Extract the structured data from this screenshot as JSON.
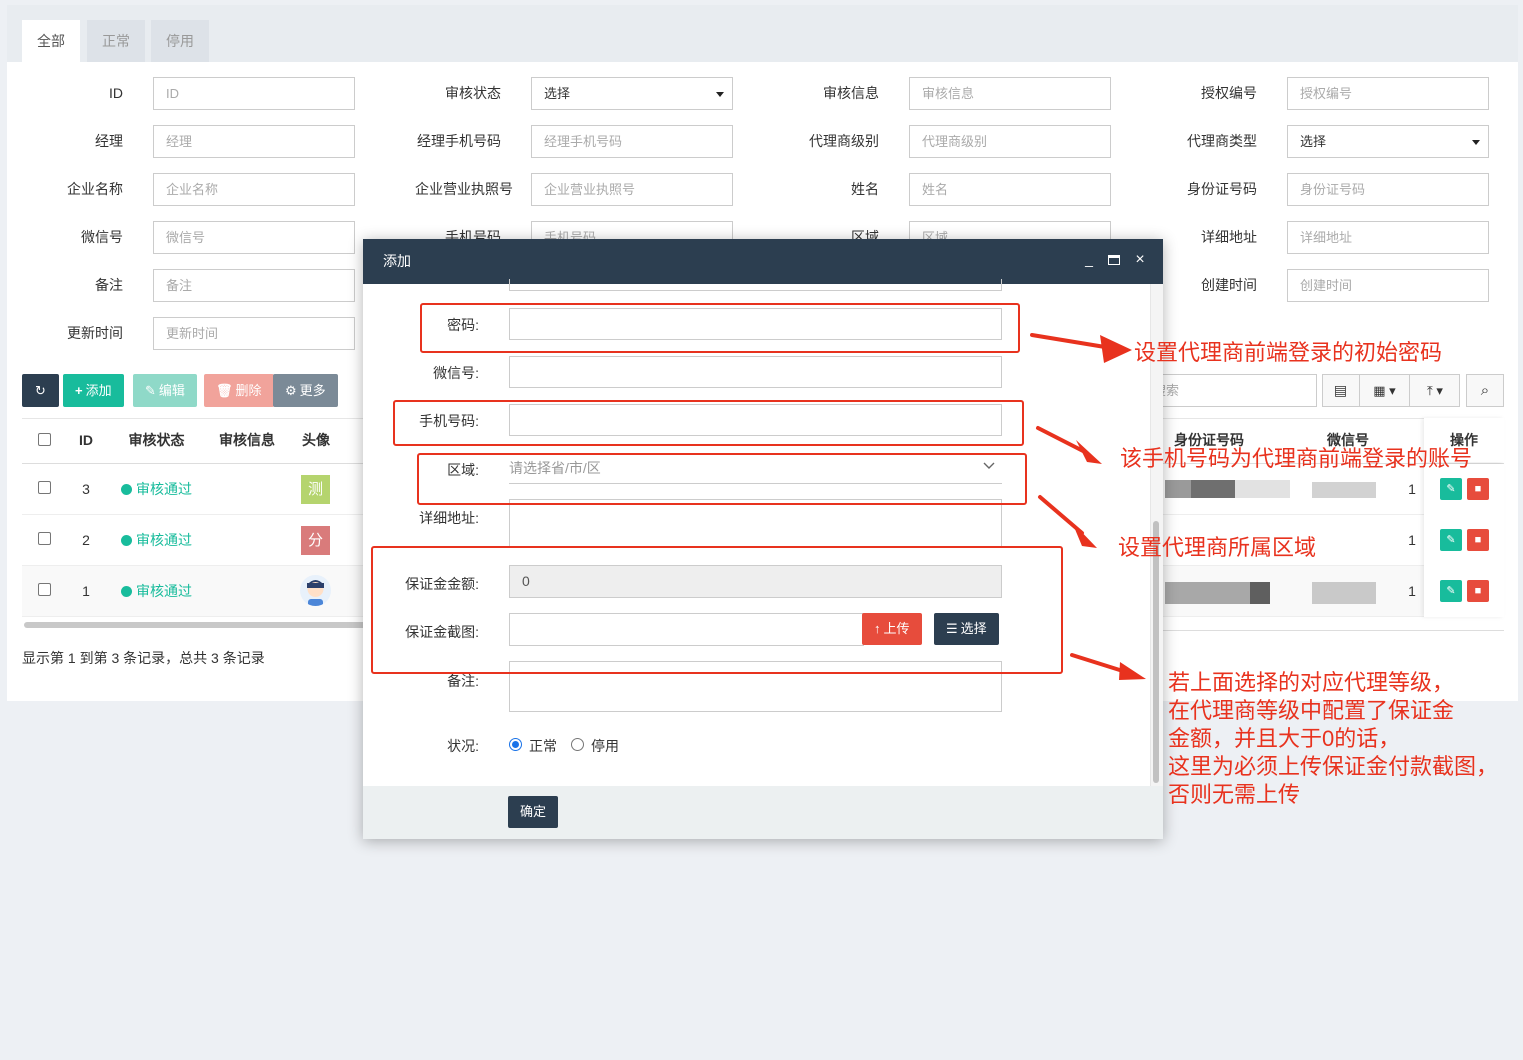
{
  "tabs": [
    {
      "label": "全部"
    },
    {
      "label": "正常"
    },
    {
      "label": "停用"
    }
  ],
  "filters": {
    "id": {
      "label": "ID",
      "placeholder": "ID"
    },
    "audit_status": {
      "label": "审核状态",
      "value": "选择"
    },
    "audit_info": {
      "label": "审核信息",
      "placeholder": "审核信息"
    },
    "auth_no": {
      "label": "授权编号",
      "placeholder": "授权编号"
    },
    "manager": {
      "label": "经理",
      "placeholder": "经理"
    },
    "manager_phone": {
      "label": "经理手机号码",
      "placeholder": "经理手机号码"
    },
    "agent_level": {
      "label": "代理商级别",
      "placeholder": "代理商级别"
    },
    "agent_type": {
      "label": "代理商类型",
      "value": "选择"
    },
    "company": {
      "label": "企业名称",
      "placeholder": "企业名称"
    },
    "license": {
      "label": "企业营业执照号",
      "placeholder": "企业营业执照号"
    },
    "name": {
      "label": "姓名",
      "placeholder": "姓名"
    },
    "idcard": {
      "label": "身份证号码",
      "placeholder": "身份证号码"
    },
    "wechat": {
      "label": "微信号",
      "placeholder": "微信号"
    },
    "phone": {
      "label": "手机号码",
      "placeholder": "手机号码"
    },
    "region": {
      "label": "区域",
      "placeholder": "区域"
    },
    "address": {
      "label": "详细地址",
      "placeholder": "详细地址"
    },
    "remark": {
      "label": "备注",
      "placeholder": "备注"
    },
    "created": {
      "label": "创建时间",
      "placeholder": "创建时间"
    },
    "updated": {
      "label": "更新时间",
      "placeholder": "更新时间"
    }
  },
  "toolbar": {
    "add": "添加",
    "edit": "编辑",
    "delete": "删除",
    "more": "更多",
    "search_placeholder": "搜索"
  },
  "table": {
    "headers": {
      "id": "ID",
      "status": "审核状态",
      "info": "审核信息",
      "avatar": "头像",
      "idcard": "身份证号码",
      "wechat": "微信号",
      "ops": "操作"
    },
    "rows": [
      {
        "id": "3",
        "status": "审核通过",
        "avatar_text": "测",
        "avatar_color": "#b5d46e",
        "col": "1"
      },
      {
        "id": "2",
        "status": "审核通过",
        "avatar_text": "分",
        "avatar_color": "#d97b7b",
        "col": "1"
      },
      {
        "id": "1",
        "status": "审核通过",
        "avatar_text": "",
        "avatar_color": "#ffffff",
        "col": "1"
      }
    ],
    "footer": "显示第 1 到第 3 条记录，总共 3 条记录"
  },
  "modal": {
    "title": "添加",
    "fields": {
      "password": "密码:",
      "wechat": "微信号:",
      "phone": "手机号码:",
      "region": "区域:",
      "region_placeholder": "请选择省/市/区",
      "address": "详细地址:",
      "deposit_amount": "保证金金额:",
      "deposit_value": "0",
      "deposit_image": "保证金截图:",
      "upload": "上传",
      "choose": "选择",
      "remark": "备注:",
      "status": "状况:",
      "status_normal": "正常",
      "status_disabled": "停用"
    },
    "confirm": "确定"
  },
  "annotations": {
    "password": "设置代理商前端登录的初始密码",
    "phone": "该手机号码为代理商前端登录的账号",
    "region": "设置代理商所属区域",
    "deposit_lines": [
      "若上面选择的对应代理等级，",
      "在代理商等级中配置了保证金",
      "金额，并且大于0的话，",
      "这里为必须上传保证金付款截图，",
      "否则无需上传"
    ]
  },
  "colors": {
    "primary": "#18bc9c",
    "dark": "#2c3e50",
    "danger": "#e74c3c",
    "annotation": "#e8321e"
  }
}
